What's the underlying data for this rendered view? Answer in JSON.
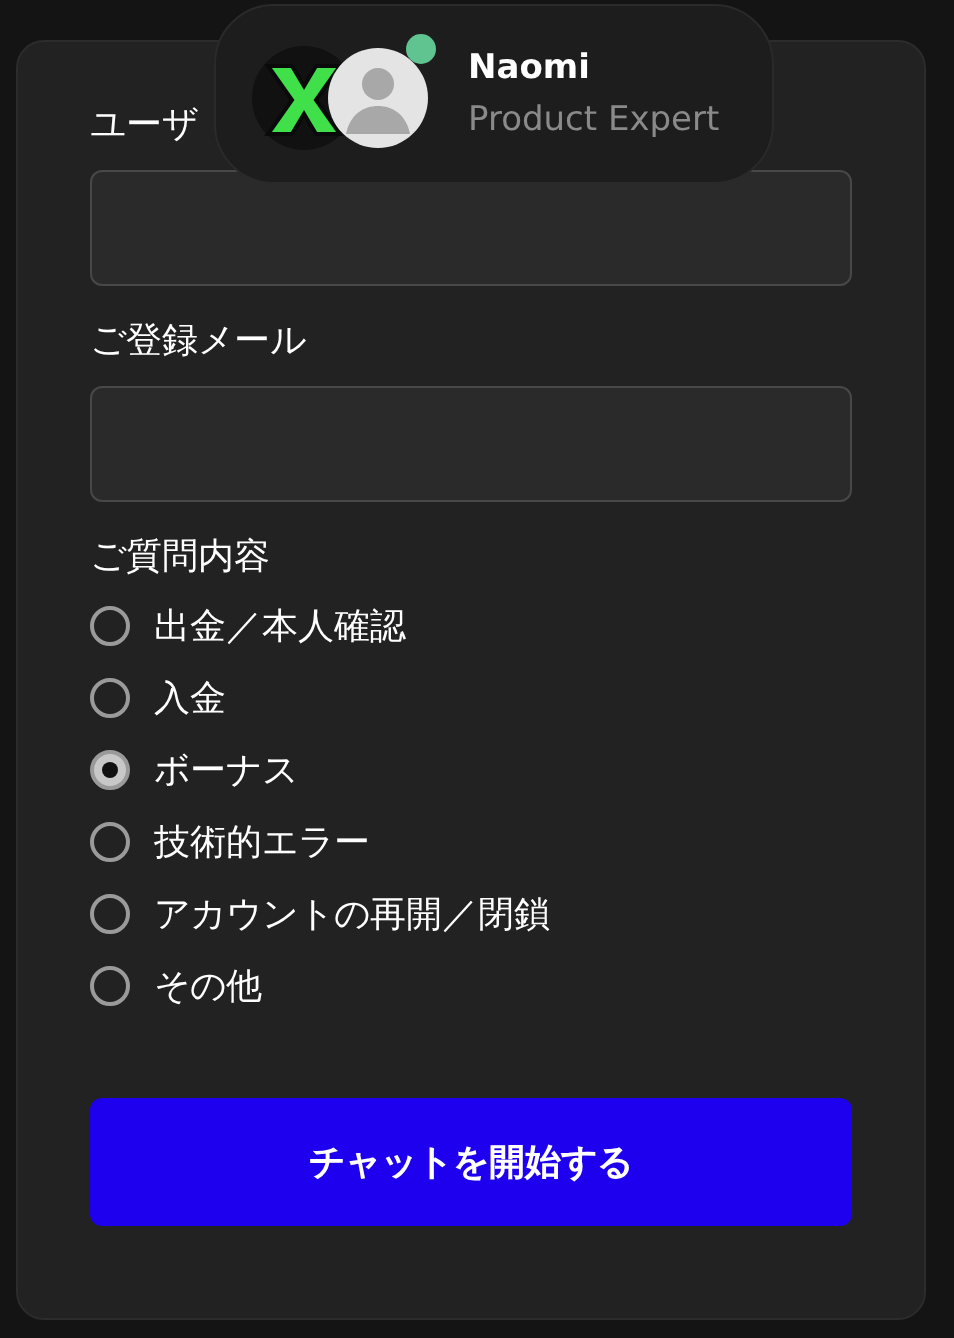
{
  "agent": {
    "name": "Naomi",
    "role": "Product Expert",
    "online": true
  },
  "fields": [
    {
      "label": "ユーザ"
    },
    {
      "label": "ご登録メール"
    }
  ],
  "question": {
    "label": "ご質問内容",
    "options": [
      {
        "label": "出金／本人確認",
        "selected": false
      },
      {
        "label": "入金",
        "selected": false
      },
      {
        "label": "ボーナス",
        "selected": true
      },
      {
        "label": "技術的エラー",
        "selected": false
      },
      {
        "label": "アカウントの再開／閉鎖",
        "selected": false
      },
      {
        "label": "その他",
        "selected": false
      }
    ]
  },
  "submit": "チャットを開始する"
}
